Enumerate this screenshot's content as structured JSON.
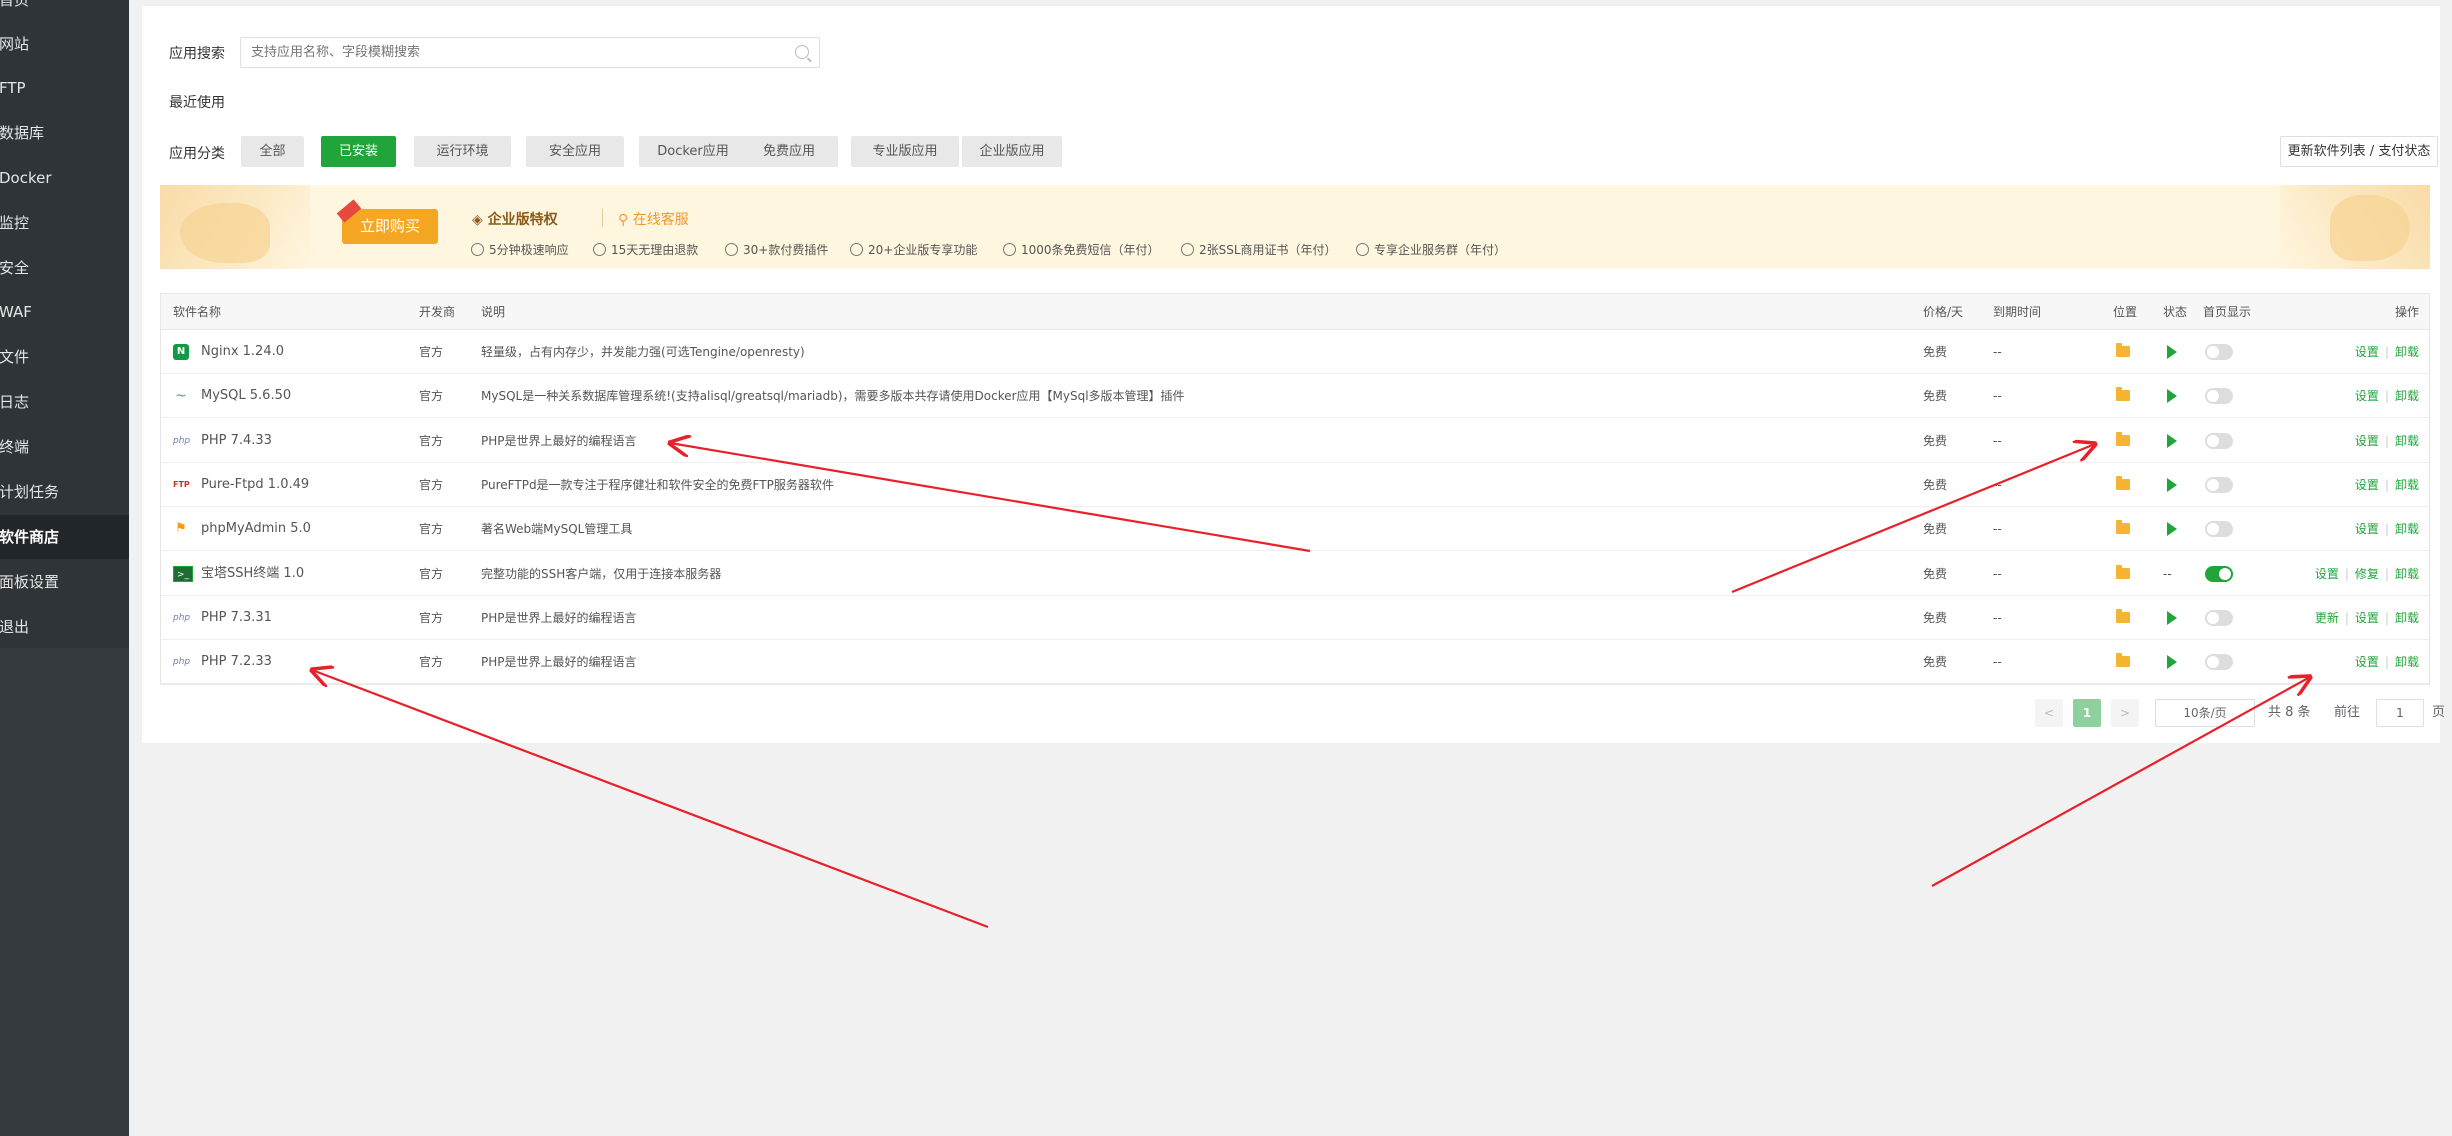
{
  "sidebar": {
    "items": [
      {
        "label": "首页"
      },
      {
        "label": "网站"
      },
      {
        "label": "FTP"
      },
      {
        "label": "数据库"
      },
      {
        "label": "Docker"
      },
      {
        "label": "监控"
      },
      {
        "label": "安全"
      },
      {
        "label": "WAF"
      },
      {
        "label": "文件"
      },
      {
        "label": "日志"
      },
      {
        "label": "终端"
      },
      {
        "label": "计划任务"
      },
      {
        "label": "软件商店"
      },
      {
        "label": "面板设置"
      },
      {
        "label": "退出"
      }
    ],
    "active_index": 12
  },
  "search": {
    "label": "应用搜索",
    "placeholder": "支持应用名称、字段模糊搜索"
  },
  "recent": {
    "label": "最近使用"
  },
  "categories": {
    "label": "应用分类",
    "items": [
      "全部",
      "已安装",
      "运行环境",
      "安全应用",
      "Docker应用",
      "免费应用",
      "专业版应用",
      "企业版应用"
    ],
    "active": "已安装",
    "update_button": "更新软件列表 / 支付状态"
  },
  "banner": {
    "buy_button": "立即购买",
    "title": "企业版特权",
    "service": "在线客服",
    "features": [
      "5分钟极速响应",
      "15天无理由退款",
      "30+款付费插件",
      "20+企业版专享功能",
      "1000条免费短信（年付）",
      "2张SSL商用证书（年付）",
      "专享企业服务群（年付）"
    ]
  },
  "table": {
    "headers": {
      "name": "软件名称",
      "developer": "开发商",
      "desc": "说明",
      "price": "价格/天",
      "expire": "到期时间",
      "location": "位置",
      "status": "状态",
      "homepage": "首页显示",
      "ops": "操作"
    },
    "rows": [
      {
        "icon": "nginx-icon",
        "name": "Nginx 1.24.0",
        "developer": "官方",
        "desc": "轻量级，占有内存少，并发能力强(可选Tengine/openresty)",
        "price": "免费",
        "expire": "--",
        "status": "",
        "homepage_on": false,
        "ops": [
          "设置",
          "卸载"
        ]
      },
      {
        "icon": "mysql-icon",
        "name": "MySQL 5.6.50",
        "developer": "官方",
        "desc": "MySQL是一种关系数据库管理系统!(支持alisql/greatsql/mariadb)，需要多版本共存请使用Docker应用【MySql多版本管理】插件",
        "price": "免费",
        "expire": "--",
        "status": "",
        "homepage_on": false,
        "ops": [
          "设置",
          "卸载"
        ]
      },
      {
        "icon": "php-icon",
        "name": "PHP 7.4.33",
        "developer": "官方",
        "desc": "PHP是世界上最好的编程语言",
        "price": "免费",
        "expire": "--",
        "status": "",
        "homepage_on": false,
        "ops": [
          "设置",
          "卸载"
        ]
      },
      {
        "icon": "ftp-icon",
        "name": "Pure-Ftpd 1.0.49",
        "developer": "官方",
        "desc": "PureFTPd是一款专注于程序健壮和软件安全的免费FTP服务器软件",
        "price": "免费",
        "expire": "--",
        "status": "",
        "homepage_on": false,
        "ops": [
          "设置",
          "卸载"
        ]
      },
      {
        "icon": "phpmyadmin-icon",
        "name": "phpMyAdmin 5.0",
        "developer": "官方",
        "desc": "著名Web端MySQL管理工具",
        "price": "免费",
        "expire": "--",
        "status": "",
        "homepage_on": false,
        "ops": [
          "设置",
          "卸载"
        ]
      },
      {
        "icon": "terminal-icon",
        "name": "宝塔SSH终端 1.0",
        "developer": "官方",
        "desc": "完整功能的SSH客户端，仅用于连接本服务器",
        "price": "免费",
        "expire": "--",
        "status": "--",
        "homepage_on": true,
        "ops": [
          "设置",
          "修复",
          "卸载"
        ]
      },
      {
        "icon": "php-icon",
        "name": "PHP 7.3.31",
        "developer": "官方",
        "desc": "PHP是世界上最好的编程语言",
        "price": "免费",
        "expire": "--",
        "status": "",
        "homepage_on": false,
        "ops": [
          "更新",
          "设置",
          "卸载"
        ]
      },
      {
        "icon": "php-icon",
        "name": "PHP 7.2.33",
        "developer": "官方",
        "desc": "PHP是世界上最好的编程语言",
        "price": "免费",
        "expire": "--",
        "status": "",
        "homepage_on": false,
        "ops": [
          "设置",
          "卸载"
        ]
      }
    ]
  },
  "pagination": {
    "prev": "<",
    "current": "1",
    "next": ">",
    "page_size": "10条/页",
    "total": "共 8 条",
    "goto_label": "前往",
    "goto_value": "1",
    "page_unit": "页"
  },
  "colors": {
    "sidebar_bg": "#2e3438",
    "accent": "#20a53a",
    "annotation": "#e8202a",
    "banner_bg": "#fff6df"
  }
}
